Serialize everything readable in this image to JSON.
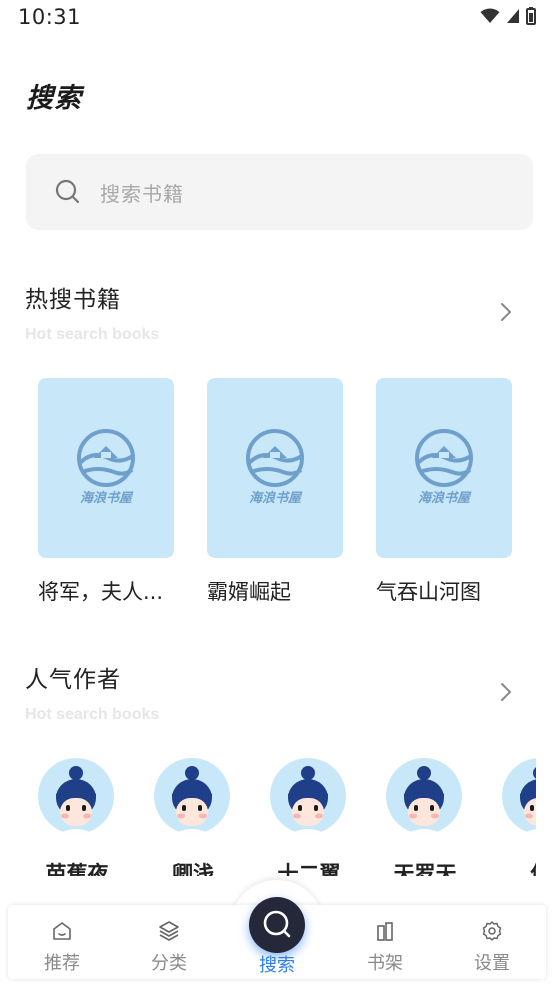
{
  "status_bar": {
    "time": "10:31"
  },
  "page": {
    "title": "搜索"
  },
  "search": {
    "placeholder": "搜索书籍"
  },
  "hot_books": {
    "title": "热搜书籍",
    "subtitle": "Hot search books",
    "books": [
      {
        "title": "将军，夫人...",
        "cover_logo_text": "海浪书屋"
      },
      {
        "title": "霸婿崛起",
        "cover_logo_text": "海浪书屋"
      },
      {
        "title": "气吞山河图",
        "cover_logo_text": "海浪书屋"
      }
    ]
  },
  "popular_authors": {
    "title": "人气作者",
    "subtitle": "Hot search books",
    "authors": [
      {
        "name": "芭蕉夜"
      },
      {
        "name": "卿浅"
      },
      {
        "name": "十二翼"
      },
      {
        "name": "天罗天"
      },
      {
        "name": "佚"
      }
    ]
  },
  "tab_bar": {
    "items": [
      {
        "label": "推荐",
        "icon": "home-icon"
      },
      {
        "label": "分类",
        "icon": "layers-icon"
      },
      {
        "label": "搜索",
        "icon": "search-icon",
        "active": true
      },
      {
        "label": "书架",
        "icon": "bookshelf-icon"
      },
      {
        "label": "设置",
        "icon": "gear-icon"
      }
    ]
  },
  "colors": {
    "accent": "#2f7ff3",
    "cover_bg": "#c8e8fa",
    "logo": "#6f9fcb",
    "center_button": "#242838"
  }
}
